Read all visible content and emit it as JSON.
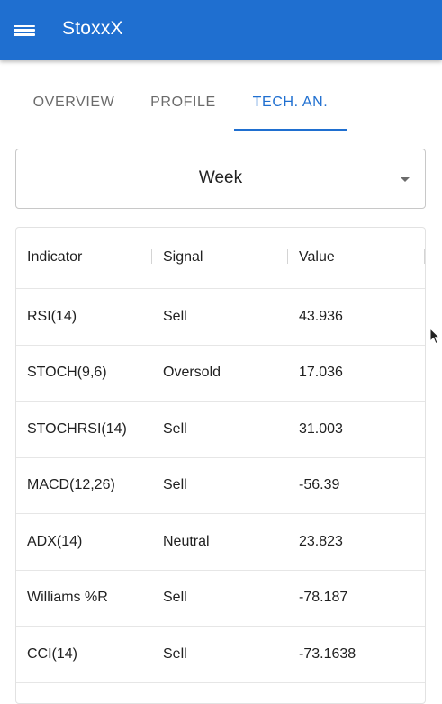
{
  "app": {
    "title": "StoxxX",
    "menu_icon": "hamburger-menu-icon",
    "brand_color": "#1f6fd0"
  },
  "tabs": [
    {
      "label": "OVERVIEW",
      "active": false
    },
    {
      "label": "PROFILE",
      "active": false
    },
    {
      "label": "TECH. AN.",
      "active": true
    }
  ],
  "period_select": {
    "value": "Week",
    "icon": "dropdown-arrow-icon"
  },
  "table": {
    "columns": [
      "Indicator",
      "Signal",
      "Value"
    ],
    "rows": [
      {
        "indicator": "RSI(14)",
        "signal": "Sell",
        "value": "43.936"
      },
      {
        "indicator": "STOCH(9,6)",
        "signal": "Oversold",
        "value": "17.036"
      },
      {
        "indicator": "STOCHRSI(14)",
        "signal": "Sell",
        "value": "31.003"
      },
      {
        "indicator": "MACD(12,26)",
        "signal": "Sell",
        "value": "-56.39"
      },
      {
        "indicator": "ADX(14)",
        "signal": "Neutral",
        "value": "23.823"
      },
      {
        "indicator": "Williams %R",
        "signal": "Sell",
        "value": "-78.187"
      },
      {
        "indicator": "CCI(14)",
        "signal": "Sell",
        "value": "-73.1638"
      },
      {
        "indicator": "",
        "signal": "",
        "value": ""
      }
    ]
  }
}
